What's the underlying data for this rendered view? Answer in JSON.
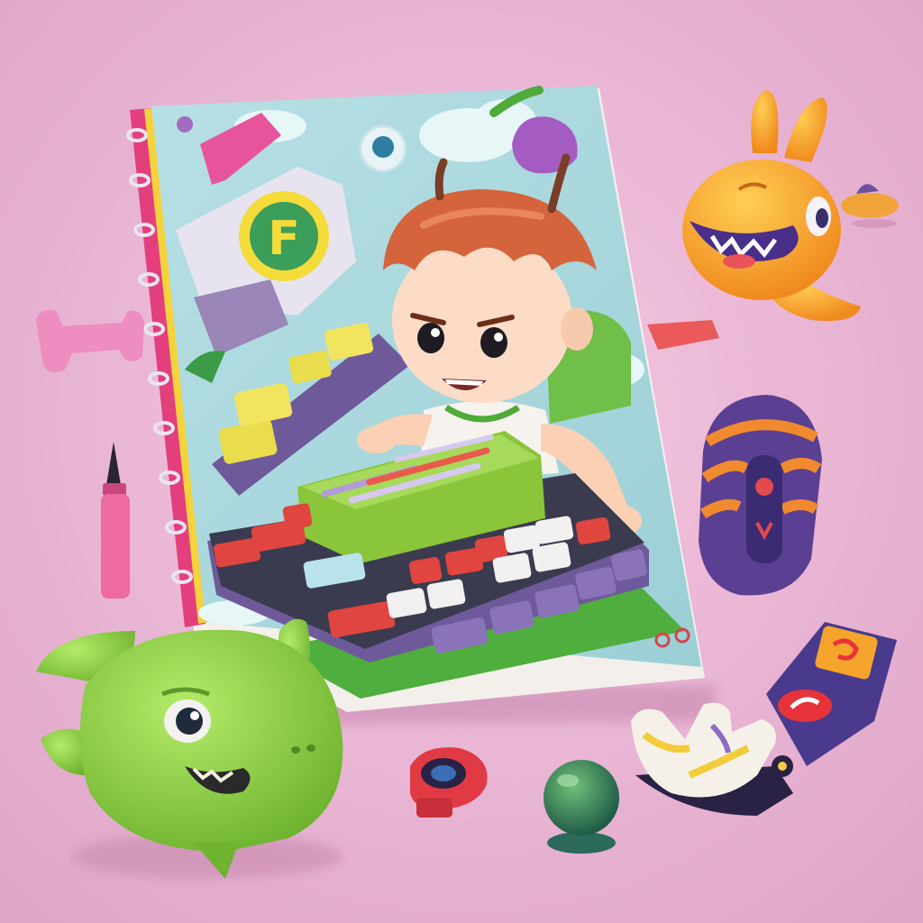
{
  "scene": {
    "background_color": "#eab7d6",
    "book": {
      "cover_color": "#a9d6da",
      "spine_color": "#e43f7d",
      "badge_letter": "F",
      "character_hair_color": "#d5643c",
      "keyboard_green": "#8ac53a",
      "keyboard_purple": "#6e5a9a"
    },
    "toys": {
      "green_monster_color": "#8fd048",
      "orange_monster_color": "#f6a12b",
      "striped_figure_colors": [
        "#f18a2e",
        "#5b3f93"
      ],
      "phone_colors": [
        "#4a3a8e",
        "#f6a42b",
        "#e8323a"
      ]
    }
  }
}
